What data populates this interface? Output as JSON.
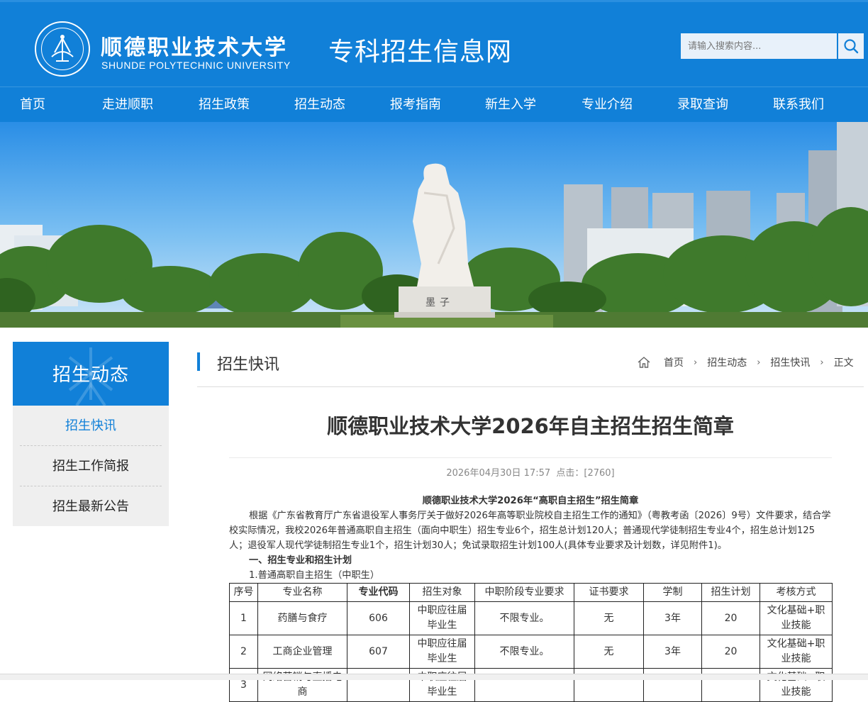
{
  "header": {
    "logo_cn": "顺德职业技术大学",
    "logo_en": "SHUNDE POLYTECHNIC UNIVERSITY",
    "site_title": "专科招生信息网",
    "search_placeholder": "请输入搜索内容..."
  },
  "nav": {
    "items": [
      {
        "label": "首页"
      },
      {
        "label": "走进顺职"
      },
      {
        "label": "招生政策"
      },
      {
        "label": "招生动态"
      },
      {
        "label": "报考指南"
      },
      {
        "label": "新生入学"
      },
      {
        "label": "专业介绍"
      },
      {
        "label": "录取查询"
      },
      {
        "label": "联系我们"
      }
    ]
  },
  "banner": {
    "statue_plaque": "墨子"
  },
  "sidebar": {
    "title": "招生动态",
    "items": [
      {
        "label": "招生快讯",
        "active": true
      },
      {
        "label": "招生工作简报",
        "active": false
      },
      {
        "label": "招生最新公告",
        "active": false
      }
    ]
  },
  "section": {
    "title": "招生快讯",
    "breadcrumb": [
      "首页",
      "招生动态",
      "招生快讯",
      "正文"
    ]
  },
  "article": {
    "title": "顺德职业技术大学2026年自主招生招生简章",
    "date": "2026年04月30日 17:57",
    "clicks_label": "点击：",
    "clicks": "[2760]",
    "subtitle": "顺德职业技术大学2026年“高职自主招生”招生简章",
    "paragraph": "根据《广东省教育厅广东省退役军人事务厅关于做好2026年高等职业院校自主招生工作的通知》（粤教考函〔2026〕9号）文件要求，结合学校实际情况，我校2026年普通高职自主招生（面向中职生）招生专业6个，招生总计划120人；普通现代学徒制招生专业4个，招生总计划125人；退役军人现代学徒制招生专业1个，招生计划30人；免试录取招生计划100人(具体专业要求及计划数，详见附件1)。",
    "heading1": "一、招生专业和招生计划",
    "heading2": "1.普通高职自主招生（中职生）"
  },
  "table": {
    "headers": [
      "序号",
      "专业名称",
      "专业代码",
      "招生对象",
      "中职阶段专业要求",
      "证书要求",
      "学制",
      "招生计划",
      "考核方式"
    ],
    "rows": [
      [
        "1",
        "药膳与食疗",
        "606",
        "中职应往届毕业生",
        "不限专业。",
        "无",
        "3年",
        "20",
        "文化基础+职业技能"
      ],
      [
        "2",
        "工商企业管理",
        "607",
        "中职应往届毕业生",
        "不限专业。",
        "无",
        "3年",
        "20",
        "文化基础+职业技能"
      ],
      [
        "3",
        "网络营销与直播电商",
        "",
        "中职应往届毕业生",
        "",
        "",
        "",
        "",
        "文化基础+职业技能"
      ]
    ]
  },
  "colors": {
    "brand_blue": "#1180d8",
    "sidebar_bg": "#efefef"
  },
  "icons": {
    "search": "search-icon",
    "home": "home-icon",
    "breadcrumb_separator": "chevron-right-icon"
  }
}
